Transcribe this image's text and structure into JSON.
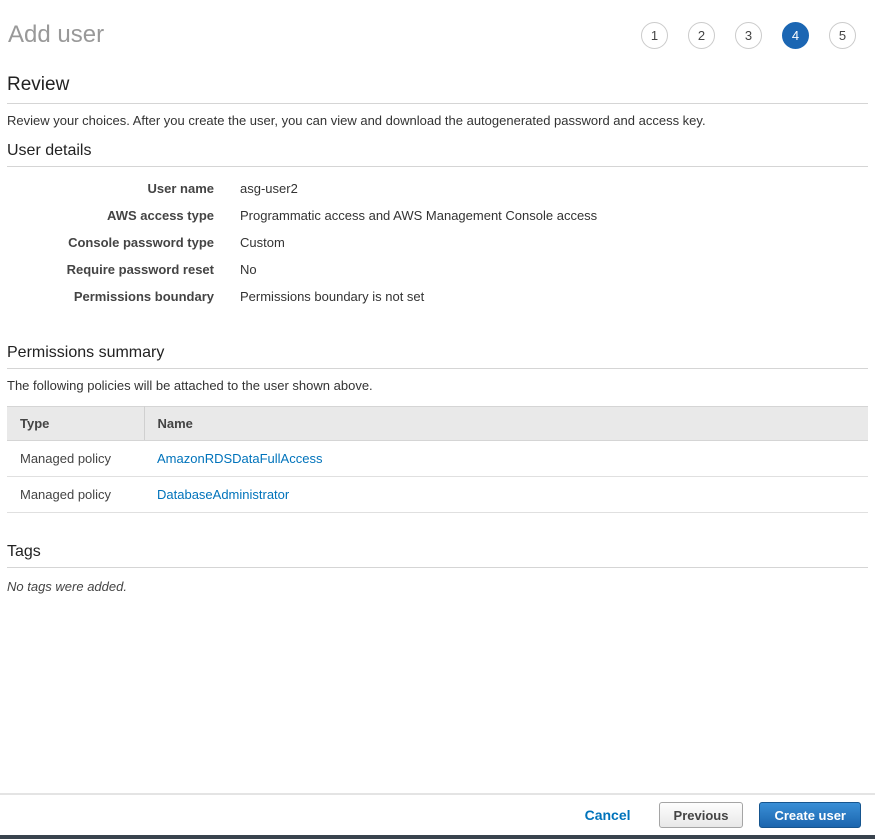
{
  "header": {
    "title": "Add user",
    "steps": [
      {
        "label": "1",
        "active": false
      },
      {
        "label": "2",
        "active": false
      },
      {
        "label": "3",
        "active": false
      },
      {
        "label": "4",
        "active": true
      },
      {
        "label": "5",
        "active": false
      }
    ]
  },
  "review": {
    "heading": "Review",
    "description": "Review your choices. After you create the user, you can view and download the autogenerated password and access key."
  },
  "user_details": {
    "heading": "User details",
    "rows": [
      {
        "label": "User name",
        "value": "asg-user2"
      },
      {
        "label": "AWS access type",
        "value": "Programmatic access and AWS Management Console access"
      },
      {
        "label": "Console password type",
        "value": "Custom"
      },
      {
        "label": "Require password reset",
        "value": "No"
      },
      {
        "label": "Permissions boundary",
        "value": "Permissions boundary is not set"
      }
    ]
  },
  "permissions_summary": {
    "heading": "Permissions summary",
    "description": "The following policies will be attached to the user shown above.",
    "table": {
      "columns": [
        "Type",
        "Name"
      ],
      "rows": [
        {
          "type": "Managed policy",
          "name": "AmazonRDSDataFullAccess"
        },
        {
          "type": "Managed policy",
          "name": "DatabaseAdministrator"
        }
      ]
    }
  },
  "tags": {
    "heading": "Tags",
    "empty_message": "No tags were added."
  },
  "footer": {
    "cancel_label": "Cancel",
    "previous_label": "Previous",
    "create_label": "Create user"
  },
  "colors": {
    "accent_blue": "#1b66b3",
    "link_blue": "#0073bb",
    "button_blue_top": "#3a8fd6",
    "button_blue_bottom": "#1b65ae",
    "header_title_gray": "#999999"
  }
}
